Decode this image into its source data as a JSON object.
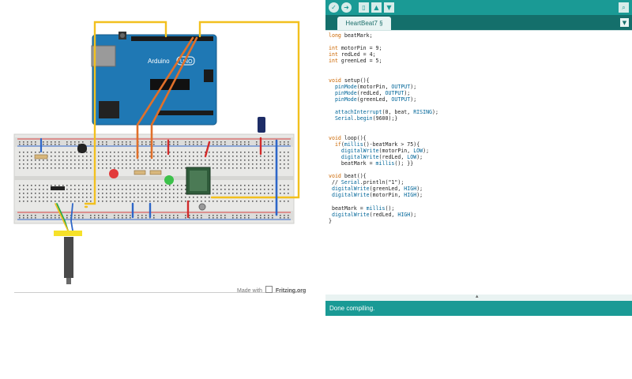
{
  "fritzing": {
    "board_label": "Arduino",
    "board_model": "UNO",
    "footer_prefix": "Made with",
    "footer_brand": "Fritzing.org"
  },
  "ide": {
    "toolbar": {
      "verify_icon": "checkmark-icon",
      "upload_icon": "right-arrow-icon",
      "new_icon": "new-file-icon",
      "open_icon": "up-arrow-icon",
      "save_icon": "down-arrow-icon",
      "serial_icon": "magnifier-icon"
    },
    "tab_title": "HeartBeat7 §",
    "status_message": "Done compiling.",
    "code_lines": [
      "long beatMark;",
      "",
      "int motorPin = 9;",
      "int redLed = 4;",
      "int greenLed = 5;",
      "",
      "",
      "void setup(){",
      "  pinMode(motorPin, OUTPUT);",
      "  pinMode(redLed, OUTPUT);",
      "  pinMode(greenLed, OUTPUT);",
      "",
      "  attachInterrupt(0, beat, RISING);",
      "  Serial.begin(9600);}",
      "",
      "",
      "void loop(){",
      "  if(millis()-beatMark > 75){",
      "    digitalWrite(motorPin, LOW);",
      "    digitalWrite(redLed, LOW);",
      "    beatMark = millis(); }}",
      "",
      "void beat(){",
      " // Serial.println(\"1\");",
      " digitalWrite(greenLed, HIGH);",
      " digitalWrite(motorPin, HIGH);",
      "",
      " beatMark = millis();",
      " digitalWrite(redLed, HIGH);",
      "}"
    ]
  },
  "colors": {
    "ide_teal": "#1a9a95",
    "ide_dark_teal": "#146f6b",
    "arduino_blue": "#1f78b4",
    "wire_yellow": "#f2c01e",
    "wire_orange": "#e0702a",
    "wire_red": "#d22b2b",
    "wire_blue": "#2d66c8"
  }
}
